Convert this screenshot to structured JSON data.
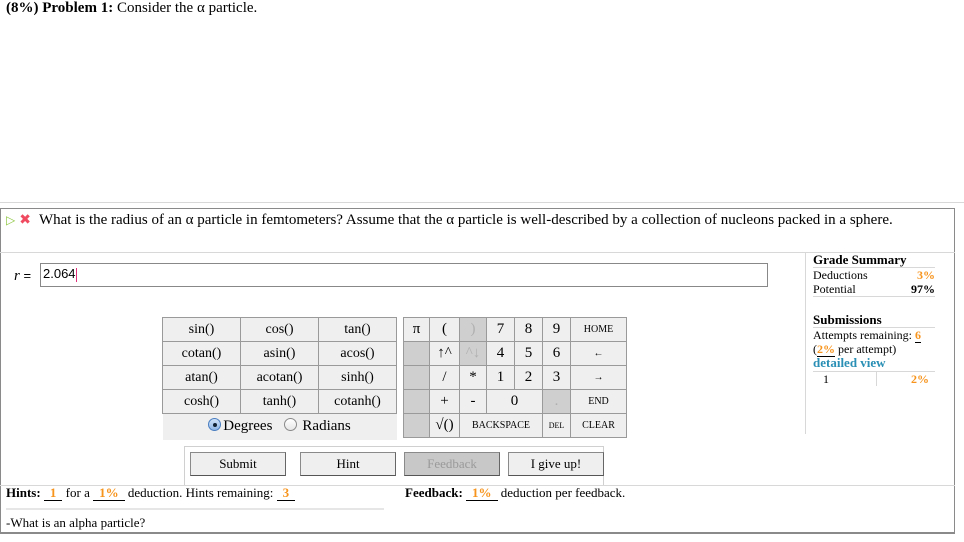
{
  "problem": {
    "weight": "(8%)",
    "label": "Problem 1:",
    "statement": "Consider the α particle."
  },
  "question": {
    "play_icon": "play-triangle",
    "status_icon": "red-x",
    "text": "What is the radius of an α particle in femtometers? Assume that the α particle is well-described by a collection of nucleons packed in a sphere."
  },
  "answer": {
    "variable": "r",
    "equals": "=",
    "value": "2.064"
  },
  "calculator": {
    "functions": [
      [
        "sin()",
        "cos()",
        "tan()"
      ],
      [
        "cotan()",
        "asin()",
        "acos()"
      ],
      [
        "atan()",
        "acotan()",
        "sinh()"
      ],
      [
        "cosh()",
        "tanh()",
        "cotanh()"
      ]
    ],
    "angle_mode": {
      "options": [
        "Degrees",
        "Radians"
      ],
      "selected": "Degrees"
    },
    "keys": {
      "pi": "π",
      "lparen": "(",
      "rparen": ")",
      "seven": "7",
      "eight": "8",
      "nine": "9",
      "home": "HOME",
      "up": "↑^",
      "down": "^↓",
      "four": "4",
      "five": "5",
      "six": "6",
      "left": "←",
      "divide": "/",
      "multiply": "*",
      "one": "1",
      "two": "2",
      "three": "3",
      "right": "→",
      "plus": "+",
      "minus": "-",
      "zero": "0",
      "dot": ".",
      "end": "END",
      "sqrt": "√()",
      "backspace": "BACKSPACE",
      "del": "DEL",
      "clear": "CLEAR"
    }
  },
  "buttons": {
    "submit": "Submit",
    "hint": "Hint",
    "feedback": "Feedback",
    "give_up": "I give up!"
  },
  "hints": {
    "label": "Hints:",
    "count": "1",
    "for_a": "for a",
    "deduction": "1%",
    "deduction_text": "deduction. Hints remaining:",
    "remaining": "3",
    "hint_text": "-What is an alpha particle?"
  },
  "feedback": {
    "label": "Feedback:",
    "deduction": "1%",
    "text": "deduction per feedback."
  },
  "grade_summary": {
    "title": "Grade Summary",
    "deductions_label": "Deductions",
    "deductions_value": "3%",
    "potential_label": "Potential",
    "potential_value": "97%",
    "submissions_title": "Submissions",
    "attempts_label": "Attempts remaining:",
    "attempts_value": "6",
    "per_attempt_open": "(",
    "per_attempt_value": "2%",
    "per_attempt_text": "per attempt)",
    "detailed_view": "detailed view",
    "submission_rows": [
      {
        "number": "1",
        "deduction": "2%"
      }
    ]
  },
  "colors": {
    "accent_orange": "#f7941d",
    "link_blue": "#2a8fb5",
    "play_green": "#8cc63f",
    "error_red": "#ef4a5f"
  }
}
